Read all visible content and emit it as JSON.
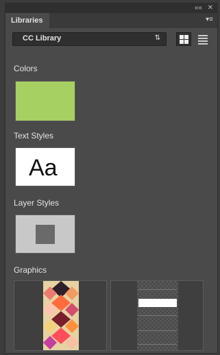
{
  "window": {
    "collapse_icon": "double-left-arrow-icon",
    "close_icon": "close-icon"
  },
  "panel": {
    "tab_label": "Libraries",
    "menu_icon": "panel-menu-icon"
  },
  "library_selector": {
    "selected": "CC Library",
    "arrows_icon": "updown-arrows-icon"
  },
  "view_buttons": {
    "grid_view": "grid-view-icon",
    "list_view": "list-view-icon",
    "grid_selected": true
  },
  "sections": {
    "colors": {
      "title": "Colors",
      "swatch": "#a7d062"
    },
    "text_styles": {
      "title": "Text Styles",
      "sample": "Aa"
    },
    "layer_styles": {
      "title": "Layer Styles"
    },
    "graphics": {
      "title": "Graphics"
    }
  }
}
